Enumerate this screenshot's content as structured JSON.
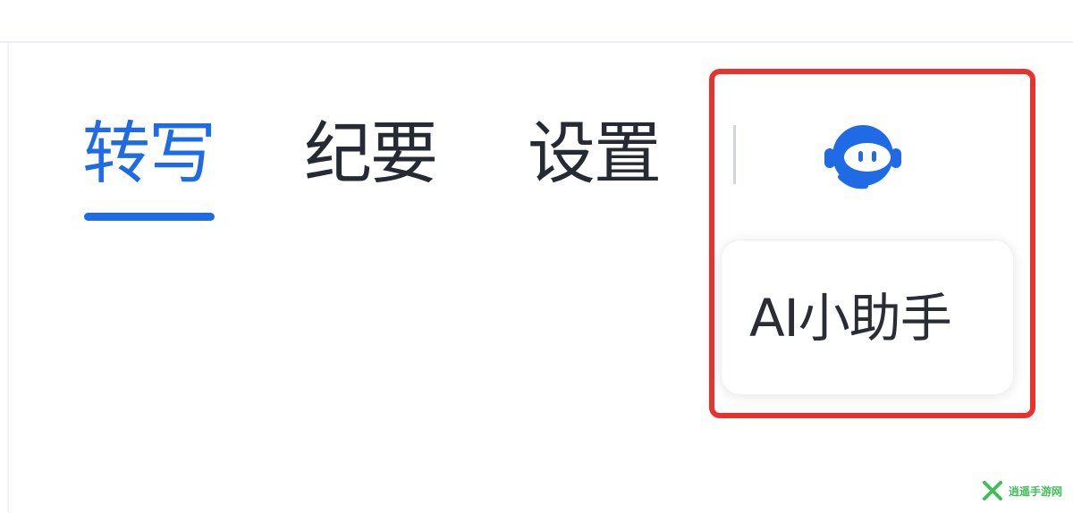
{
  "tabs": [
    {
      "label": "转写",
      "active": true
    },
    {
      "label": "纪要",
      "active": false
    },
    {
      "label": "设置",
      "active": false
    }
  ],
  "assistant": {
    "icon": "robot-headset-icon",
    "tooltip": "AI小助手"
  },
  "colors": {
    "accent": "#1f6be6",
    "highlight": "#e8322d",
    "text": "#262a33"
  },
  "watermark": {
    "text": "逍遥手游网"
  }
}
